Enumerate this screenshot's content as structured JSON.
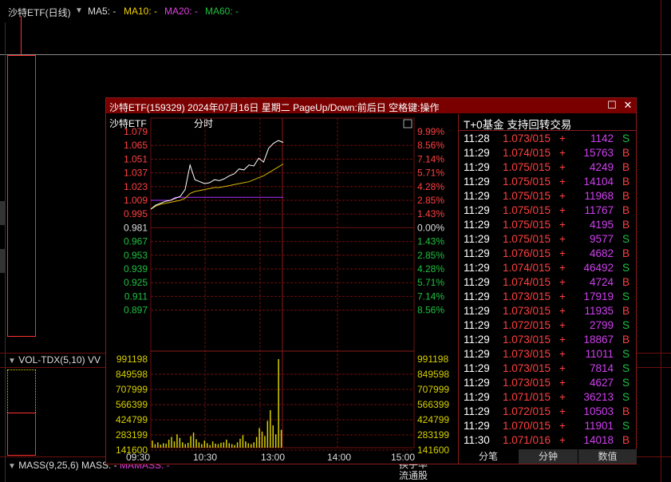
{
  "main": {
    "title": "沙特ETF(日线)",
    "ma_labels": [
      {
        "label": "MA5:",
        "value": "-",
        "color": "#dddddd"
      },
      {
        "label": "MA10:",
        "value": "-",
        "color": "#f0d000"
      },
      {
        "label": "MA20:",
        "value": "-",
        "color": "#e040e0"
      },
      {
        "label": "MA60:",
        "value": "-",
        "color": "#20c040"
      }
    ],
    "vol_label": "VOL-TDX(5,10)",
    "vol_suffix": "VV",
    "mass_label": "MASS(9,25,6)",
    "mass_value": "MASS: -",
    "mamass_value": "MAMASS: -",
    "side_labels": [
      "换手率",
      "流通股"
    ]
  },
  "popup": {
    "title": "沙特ETF(159329) 2024年07月16日 星期二 PageUp/Down:前后日 空格键:操作",
    "chart_name": "沙特ETF",
    "chart_mode": "分时",
    "trades_title": "T+0基金 支持回转交易",
    "tabs": [
      "分笔",
      "分钟",
      "数值"
    ],
    "colors": {
      "up": "#ff4040",
      "down": "#20c040",
      "flat": "#dddddd",
      "volume": "#d8d000",
      "avg": "#d8b800",
      "purple": "#b030ff",
      "grid": "#6b1010"
    }
  },
  "chart_data": {
    "type": "line",
    "title": "沙特ETF 分时",
    "price_ticks": [
      "1.079",
      "1.065",
      "1.051",
      "1.037",
      "1.023",
      "1.009",
      "0.995",
      "0.981",
      "0.967",
      "0.953",
      "0.939",
      "0.925",
      "0.911",
      "0.897"
    ],
    "pct_ticks": [
      "9.99%",
      "8.56%",
      "7.14%",
      "5.71%",
      "4.28%",
      "2.85%",
      "1.43%",
      "0.00%",
      "1.43%",
      "2.85%",
      "4.28%",
      "5.71%",
      "7.14%",
      "8.56%"
    ],
    "volume_ticks": [
      "991198",
      "849598",
      "707999",
      "566399",
      "424799",
      "283199",
      "141600"
    ],
    "time_ticks": [
      "09:30",
      "10:30",
      "13:00",
      "14:00",
      "15:00"
    ],
    "ylim": [
      0.897,
      1.079
    ],
    "base_price": 0.981,
    "price_series": [
      1.0,
      1.004,
      1.006,
      1.008,
      1.009,
      1.011,
      1.013,
      1.02,
      1.045,
      1.03,
      1.028,
      1.026,
      1.027,
      1.03,
      1.029,
      1.031,
      1.034,
      1.036,
      1.041,
      1.04,
      1.045,
      1.044,
      1.052,
      1.048,
      1.062,
      1.067,
      1.07,
      1.068
    ],
    "avg_series": [
      1.0,
      1.003,
      1.005,
      1.006,
      1.007,
      1.008,
      1.009,
      1.011,
      1.016,
      1.018,
      1.019,
      1.02,
      1.021,
      1.022,
      1.022,
      1.023,
      1.024,
      1.025,
      1.026,
      1.027,
      1.028,
      1.03,
      1.032,
      1.034,
      1.037,
      1.04,
      1.043,
      1.046
    ],
    "ref_series": [
      1.009,
      1.009,
      1.009,
      1.009,
      1.009,
      1.012,
      1.012,
      1.012,
      1.012,
      1.012,
      1.012,
      1.012,
      1.012,
      1.012,
      1.012,
      1.012,
      1.012,
      1.012,
      1.012,
      1.012,
      1.012,
      1.012,
      1.012,
      1.012,
      1.012,
      1.012,
      1.012,
      1.012
    ],
    "volume_series": [
      80000,
      40000,
      60000,
      35000,
      50000,
      45000,
      90000,
      120000,
      70000,
      150000,
      110000,
      60000,
      40000,
      55000,
      130000,
      170000,
      95000,
      60000,
      40000,
      80000,
      50000,
      30000,
      70000,
      45000,
      40000,
      55000,
      60000,
      90000,
      50000,
      40000,
      30000,
      60000,
      100000,
      140000,
      70000,
      50000,
      40000,
      60000,
      120000,
      220000,
      180000,
      130000,
      300000,
      420000,
      250000,
      150000,
      991198,
      200000
    ]
  },
  "trades": [
    {
      "time": "11:28",
      "price": "1.073/015",
      "sign": "+",
      "vol": "1142",
      "side": "S"
    },
    {
      "time": "11:29",
      "price": "1.074/015",
      "sign": "+",
      "vol": "15763",
      "side": "B"
    },
    {
      "time": "11:29",
      "price": "1.075/015",
      "sign": "+",
      "vol": "4249",
      "side": "B"
    },
    {
      "time": "11:29",
      "price": "1.075/015",
      "sign": "+",
      "vol": "14104",
      "side": "B"
    },
    {
      "time": "11:29",
      "price": "1.075/015",
      "sign": "+",
      "vol": "11968",
      "side": "B"
    },
    {
      "time": "11:29",
      "price": "1.075/015",
      "sign": "+",
      "vol": "11767",
      "side": "B"
    },
    {
      "time": "11:29",
      "price": "1.075/015",
      "sign": "+",
      "vol": "4195",
      "side": "B"
    },
    {
      "time": "11:29",
      "price": "1.075/015",
      "sign": "+",
      "vol": "9577",
      "side": "S"
    },
    {
      "time": "11:29",
      "price": "1.076/015",
      "sign": "+",
      "vol": "4682",
      "side": "B"
    },
    {
      "time": "11:29",
      "price": "1.074/015",
      "sign": "+",
      "vol": "46492",
      "side": "S"
    },
    {
      "time": "11:29",
      "price": "1.074/015",
      "sign": "+",
      "vol": "4724",
      "side": "B"
    },
    {
      "time": "11:29",
      "price": "1.073/015",
      "sign": "+",
      "vol": "17919",
      "side": "S"
    },
    {
      "time": "11:29",
      "price": "1.073/015",
      "sign": "+",
      "vol": "11935",
      "side": "B"
    },
    {
      "time": "11:29",
      "price": "1.072/015",
      "sign": "+",
      "vol": "2799",
      "side": "S"
    },
    {
      "time": "11:29",
      "price": "1.073/015",
      "sign": "+",
      "vol": "18867",
      "side": "B"
    },
    {
      "time": "11:29",
      "price": "1.073/015",
      "sign": "+",
      "vol": "11011",
      "side": "S"
    },
    {
      "time": "11:29",
      "price": "1.073/015",
      "sign": "+",
      "vol": "7814",
      "side": "S"
    },
    {
      "time": "11:29",
      "price": "1.073/015",
      "sign": "+",
      "vol": "4627",
      "side": "S"
    },
    {
      "time": "11:29",
      "price": "1.071/015",
      "sign": "+",
      "vol": "36213",
      "side": "S"
    },
    {
      "time": "11:29",
      "price": "1.072/015",
      "sign": "+",
      "vol": "10503",
      "side": "B"
    },
    {
      "time": "11:29",
      "price": "1.070/015",
      "sign": "+",
      "vol": "11901",
      "side": "S"
    },
    {
      "time": "11:30",
      "price": "1.071/016",
      "sign": "+",
      "vol": "14018",
      "side": "B"
    }
  ]
}
